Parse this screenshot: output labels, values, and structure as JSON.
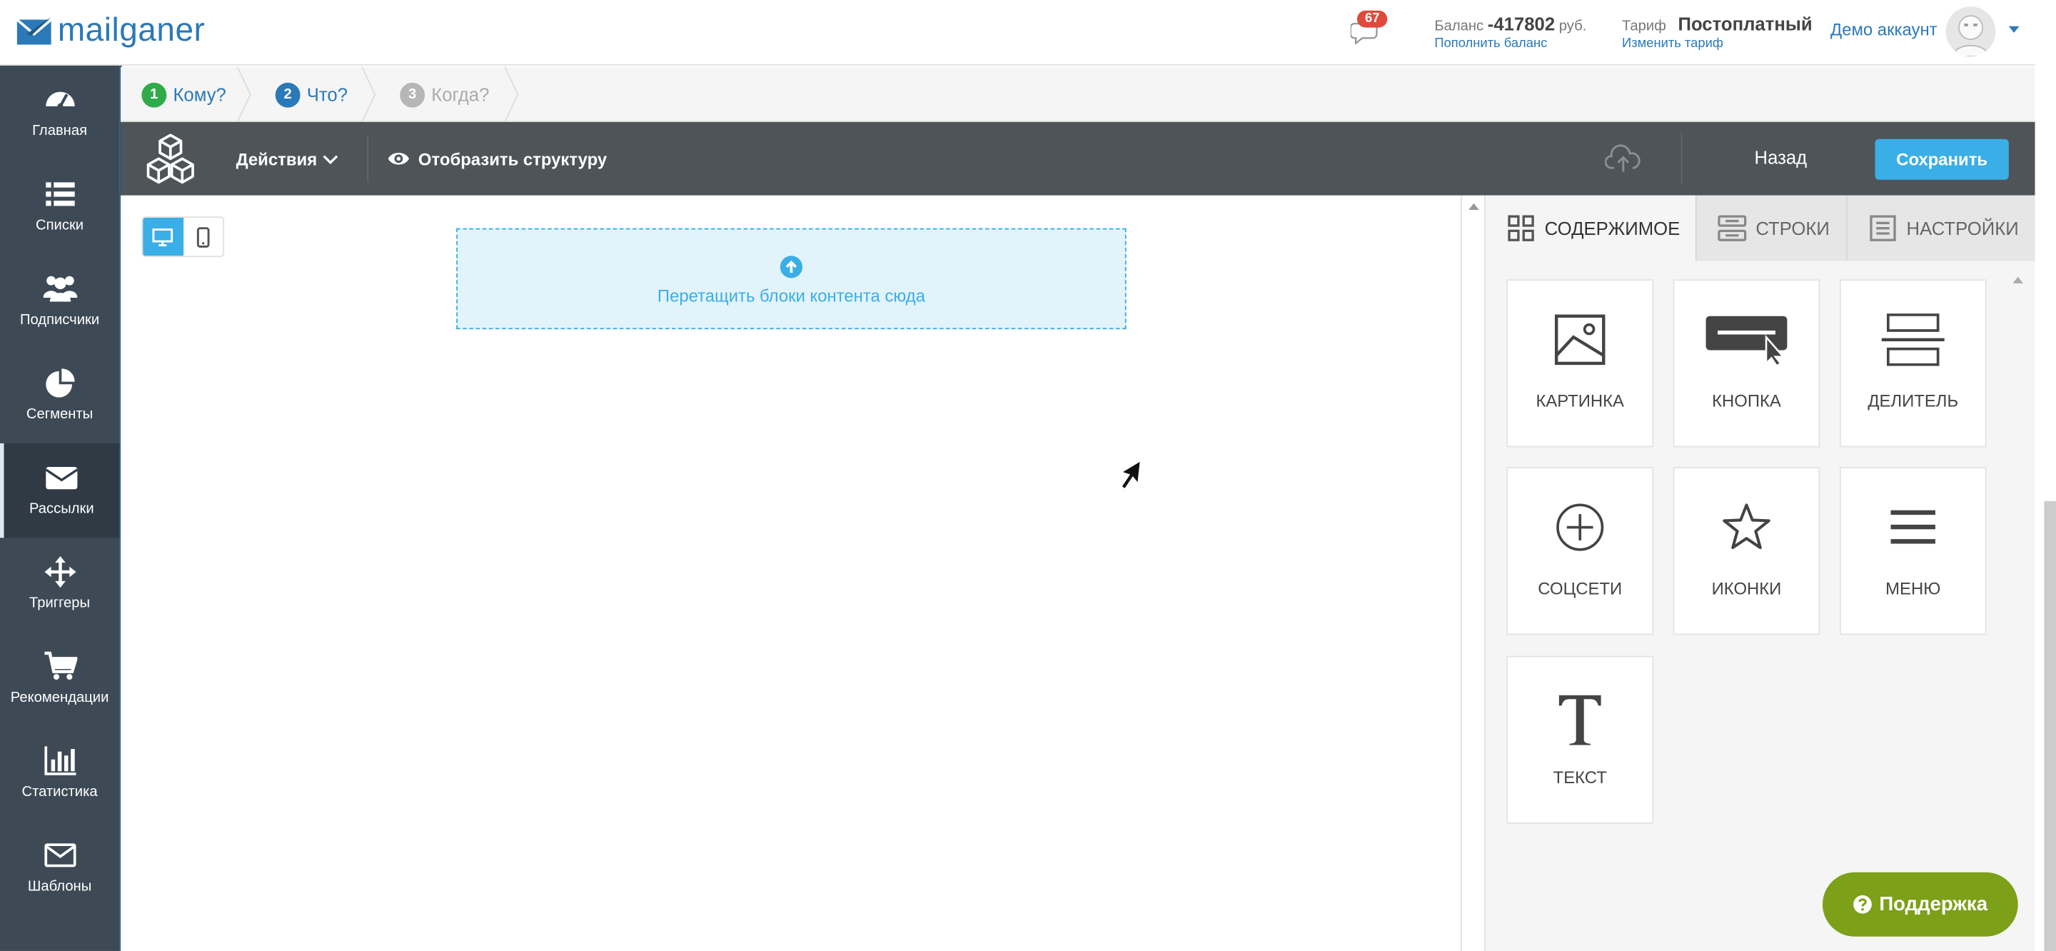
{
  "header": {
    "logo_text": "mailganer",
    "notifications_count": "67",
    "balance_label": "Баланс",
    "balance_value": "-417802",
    "balance_currency": "руб.",
    "topup_link": "Пополнить баланс",
    "tariff_label": "Тариф",
    "tariff_value": "Постоплатный",
    "change_tariff_link": "Изменить тариф",
    "account_name": "Демо аккаунт"
  },
  "sidebar": {
    "items": [
      {
        "label": "Главная",
        "icon": "dashboard-icon"
      },
      {
        "label": "Списки",
        "icon": "list-icon"
      },
      {
        "label": "Подписчики",
        "icon": "users-icon"
      },
      {
        "label": "Сегменты",
        "icon": "pie-chart-icon"
      },
      {
        "label": "Рассылки",
        "icon": "envelope-icon",
        "active": true
      },
      {
        "label": "Триггеры",
        "icon": "arrows-icon"
      },
      {
        "label": "Рекомендации",
        "icon": "cart-icon"
      },
      {
        "label": "Статистика",
        "icon": "bar-chart-icon"
      },
      {
        "label": "Шаблоны",
        "icon": "template-envelope-icon"
      }
    ]
  },
  "steps": [
    {
      "num": "1",
      "label": "Кому?",
      "color": "#2fab4a"
    },
    {
      "num": "2",
      "label": "Что?",
      "color": "#2a79b8"
    },
    {
      "num": "3",
      "label": "Когда?",
      "color": "#b6b6b6"
    }
  ],
  "toolbar": {
    "actions_label": "Действия",
    "structure_label": "Отобразить структуру",
    "back_label": "Назад",
    "save_label": "Сохранить"
  },
  "canvas": {
    "dropzone_text": "Перетащить блоки контента сюда"
  },
  "panel": {
    "tabs": [
      {
        "label": "СОДЕРЖИМОЕ",
        "icon": "grid-icon",
        "active": true
      },
      {
        "label": "СТРОКИ",
        "icon": "rows-icon"
      },
      {
        "label": "НАСТРОЙКИ",
        "icon": "settings-doc-icon"
      }
    ],
    "tiles": [
      {
        "label": "КАРТИНКА",
        "icon": "image-icon"
      },
      {
        "label": "КНОПКА",
        "icon": "button-icon"
      },
      {
        "label": "ДЕЛИТЕЛЬ",
        "icon": "divider-icon"
      },
      {
        "label": "СОЦСЕТИ",
        "icon": "social-plus-icon"
      },
      {
        "label": "ИКОНКИ",
        "icon": "star-icon"
      },
      {
        "label": "МЕНЮ",
        "icon": "menu-icon"
      },
      {
        "label": "ТЕКСТ",
        "icon": "text-icon"
      }
    ]
  },
  "support": {
    "label": "Поддержка"
  },
  "colors": {
    "accent": "#3aaee6",
    "brand": "#2a79b8",
    "sidebar": "#3d4a56",
    "support": "#7ca017"
  }
}
